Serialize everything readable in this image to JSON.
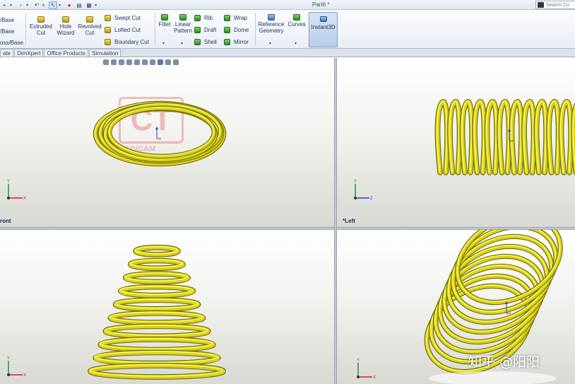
{
  "window": {
    "title": "Part6 *",
    "search_placeholder": "Search Co"
  },
  "ribbon": {
    "left_partial": [
      "/Base",
      "/Base",
      "oss/Base"
    ],
    "extruded_cut": [
      "Extruded",
      "Cut"
    ],
    "hole_wizard": [
      "Hole",
      "Wizard"
    ],
    "revolved_cut": [
      "Revolved",
      "Cut"
    ],
    "swept_cut": "Swept Cut",
    "lofted_cut": "Lofted Cut",
    "boundary_cut": "Boundary Cut",
    "fillet": "Fillet",
    "linear_pattern": [
      "Linear",
      "Pattern"
    ],
    "rib": "Rib",
    "draft": "Draft",
    "shell": "Shell",
    "wrap": "Wrap",
    "dome": "Dome",
    "mirror": "Mirror",
    "reference_geometry": [
      "Reference",
      "Geometry"
    ],
    "curves": "Curves",
    "instant3d": "Instant3D"
  },
  "tabs": [
    "ate",
    "DimXpert",
    "Office Products",
    "Simulation"
  ],
  "viewports": {
    "front_label": "ront",
    "left_label": "*Left"
  },
  "triad": {
    "x": "X",
    "y": "Y",
    "z": "Z"
  },
  "watermarks": {
    "cad_logo": "CT",
    "cad_text": "AD/CAM",
    "zhihu": "知乎 @阳阳"
  },
  "colors": {
    "spring_fill": "#d8d21a",
    "spring_dark": "#6e6a08",
    "spring_light": "#fbf66a",
    "accent": "#3b6fb6"
  }
}
